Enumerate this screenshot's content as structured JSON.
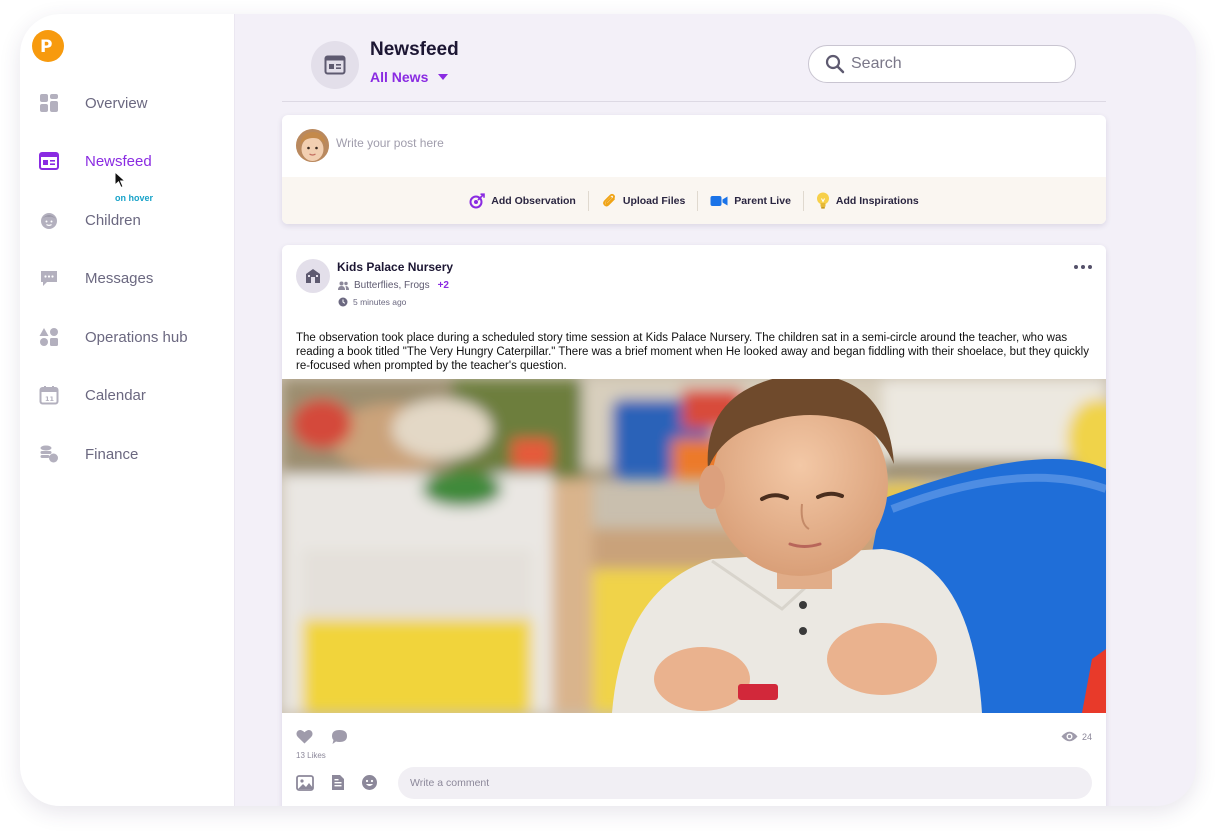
{
  "app": {
    "logo_letter": "P"
  },
  "sidebar": {
    "items": [
      {
        "label": "Overview",
        "icon": "overview-icon",
        "active": false
      },
      {
        "label": "Newsfeed",
        "icon": "newsfeed-icon",
        "active": true
      },
      {
        "label": "Children",
        "icon": "child-face-icon",
        "active": false
      },
      {
        "label": "Messages",
        "icon": "chat-bubble-icon",
        "active": false
      },
      {
        "label": "Operations hub",
        "icon": "shapes-icon",
        "active": false
      },
      {
        "label": "Calendar",
        "icon": "calendar-icon",
        "active": false
      },
      {
        "label": "Finance",
        "icon": "coins-icon",
        "active": false
      }
    ],
    "hover_hint": "on hover",
    "calendar_day": "11"
  },
  "header": {
    "title": "Newsfeed",
    "filter_label": "All News",
    "search_placeholder": "Search"
  },
  "composer": {
    "placeholder": "Write your post here",
    "actions": [
      {
        "label": "Add Observation",
        "icon": "observation-icon"
      },
      {
        "label": "Upload Files",
        "icon": "paperclip-icon"
      },
      {
        "label": "Parent Live",
        "icon": "video-camera-icon"
      },
      {
        "label": "Add Inspirations",
        "icon": "lightbulb-icon"
      }
    ]
  },
  "post": {
    "author": "Kids Palace Nursery",
    "groups": "Butterflies, Frogs",
    "groups_more": "+2",
    "time": "5 minutes ago",
    "body": "The observation took place during a scheduled story time session at Kids Palace Nursery. The children sat in a semi-circle around the teacher, who was reading a book titled \"The Very Hungry Caterpillar.\" There was a brief moment when He looked away and began fiddling with their shoelace, but they quickly re-focused when prompted by the teacher's question.",
    "likes": "13 Likes",
    "views": "24",
    "comment_placeholder": "Write a comment"
  },
  "colors": {
    "accent": "#8a2be2",
    "logo": "#f79a0e",
    "hint": "#19a3c9",
    "live": "#1a73e8"
  }
}
